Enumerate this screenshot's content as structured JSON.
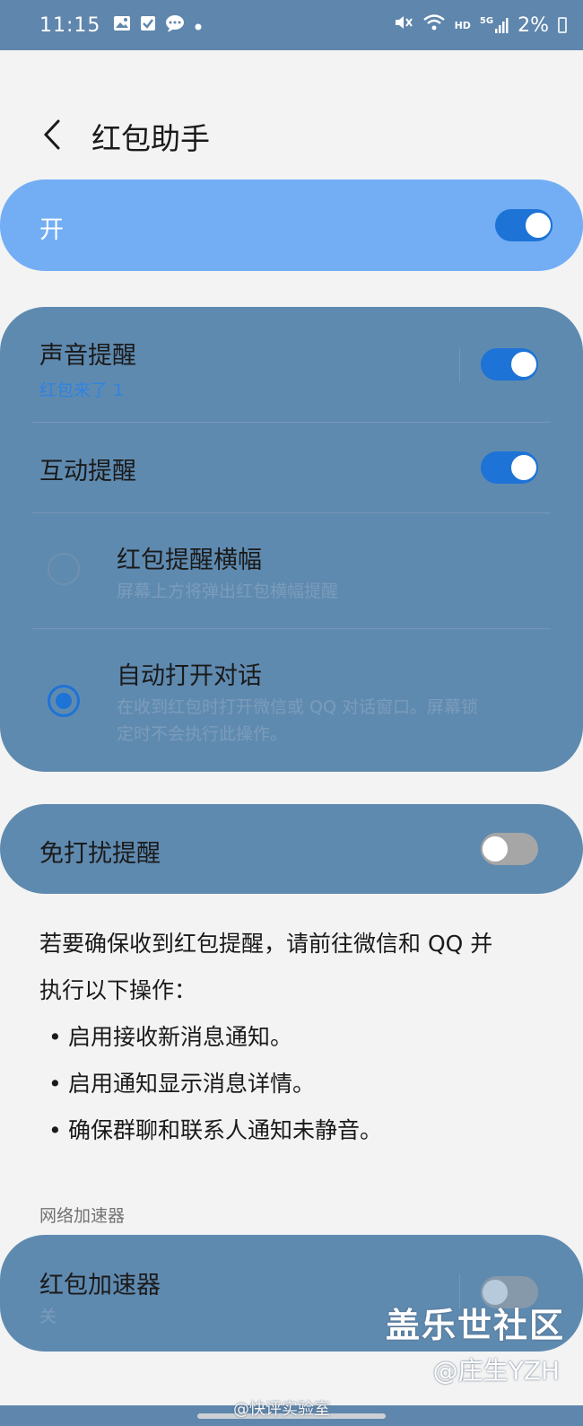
{
  "status_bar": {
    "time": "11:15",
    "battery_percent": "2%",
    "hd_label": "HD",
    "network_label": "5G",
    "left_icons": [
      "image-icon",
      "check-square-icon",
      "message-icon",
      "dot-icon"
    ],
    "right_icons": [
      "mute-icon",
      "wifi-icon",
      "signal-icon",
      "battery-icon"
    ]
  },
  "header": {
    "title": "红包助手",
    "back_icon": "chevron-left-icon"
  },
  "master_switch": {
    "label": "开",
    "on": true
  },
  "settings_group": {
    "sound_alert": {
      "title": "声音提醒",
      "subtitle": "红包来了 1",
      "on": true
    },
    "interactive_alert": {
      "title": "互动提醒",
      "on": true
    },
    "banner_option": {
      "title": "红包提醒横幅",
      "subtitle": "屏幕上方将弹出红包横幅提醒",
      "selected": false
    },
    "auto_open_option": {
      "title": "自动打开对话",
      "subtitle_line1": "在收到红包时打开微信或 QQ 对话窗口。屏幕锁",
      "subtitle_line2": "定时不会执行此操作。",
      "selected": true
    }
  },
  "dnd_alert": {
    "title": "免打扰提醒",
    "on": false
  },
  "info": {
    "line1": "若要确保收到红包提醒，请前往微信和 QQ 并",
    "line2": "执行以下操作：",
    "bullets": [
      "启用接收新消息通知。",
      "启用通知显示消息详情。",
      "确保群聊和联系人通知未静音。"
    ]
  },
  "network_section": {
    "header": "网络加速器",
    "accelerator": {
      "title": "红包加速器",
      "subtitle": "关",
      "on": false
    }
  },
  "watermarks": {
    "logo": "盖乐世社区",
    "handle": "@庄生YZH",
    "weibo": "@快评实验室"
  },
  "colors": {
    "accent": "#1d73d6",
    "card": "#5f8ab0",
    "master_card": "#73aef4",
    "status_bar": "#5f86ad"
  }
}
